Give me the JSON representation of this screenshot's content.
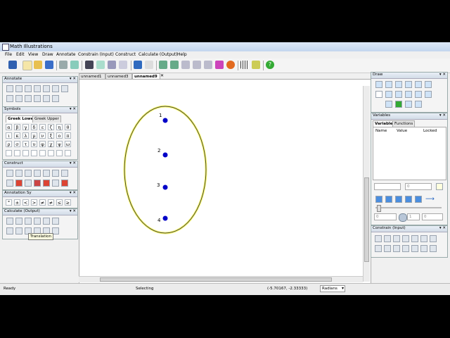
{
  "window": {
    "title": "Math Illustrations"
  },
  "menu": [
    "File",
    "Edit",
    "View",
    "Draw",
    "Annotate",
    "Constrain (Input)",
    "Construct",
    "Calculate (Output)",
    "Help"
  ],
  "toolbar": {
    "icons": [
      "pointer-icon",
      "new-icon",
      "open-icon",
      "save-icon",
      "print-icon",
      "print-preview-icon",
      "cut-icon",
      "copy-icon",
      "paste-icon",
      "select-icon",
      "undo-icon",
      "redo-icon",
      "zoom-in-icon",
      "zoom-out-icon",
      "zoom-fit-icon",
      "zoom-page-icon",
      "zoom-select-icon",
      "color-icon",
      "grid-icon",
      "measure-icon",
      "help-icon"
    ]
  },
  "doc_tabs": [
    "unnamed1",
    "unnamed3",
    "unnamed9"
  ],
  "active_doc_tab": "unnamed9",
  "panels": {
    "annotate": {
      "title": "Annotate"
    },
    "symbols": {
      "title": "Symbols",
      "tabs": [
        "Greek Lower",
        "Greek Upper"
      ],
      "greek": [
        "α",
        "β",
        "γ",
        "δ",
        "ε",
        "ζ",
        "η",
        "θ",
        "ι",
        "κ",
        "λ",
        "μ",
        "ν",
        "ξ",
        "ο",
        "π",
        "ρ",
        "σ",
        "τ",
        "υ",
        "φ",
        "χ",
        "ψ",
        "ω"
      ]
    },
    "construct": {
      "title": "Construct"
    },
    "annotation_symbols": {
      "title": "Annotation Sy",
      "symbols": [
        "°",
        "±",
        "<",
        ">",
        "≠",
        "≠",
        "≤",
        "≥"
      ]
    },
    "calculate": {
      "title": "Calculate (Output)"
    },
    "draw": {
      "title": "Draw"
    },
    "variables": {
      "title": "Variables",
      "tabs": [
        "Variables",
        "Functions"
      ],
      "columns": [
        "Name",
        "Value",
        "Locked"
      ],
      "field_value": "0",
      "slider_min": "0",
      "slider_step": "1",
      "slider_max": "0"
    },
    "constrain": {
      "title": "Constrain (Input)"
    }
  },
  "tooltip": "Translation",
  "points": [
    "1",
    "2",
    "3",
    "4"
  ],
  "status": {
    "left": "Ready",
    "mode": "Selecting",
    "coords": "(-5.70167, -2.33333)",
    "unit": "Radians"
  },
  "colors": {
    "point_fill": "#0000c8",
    "ellipse_stroke": "#d8d800"
  }
}
